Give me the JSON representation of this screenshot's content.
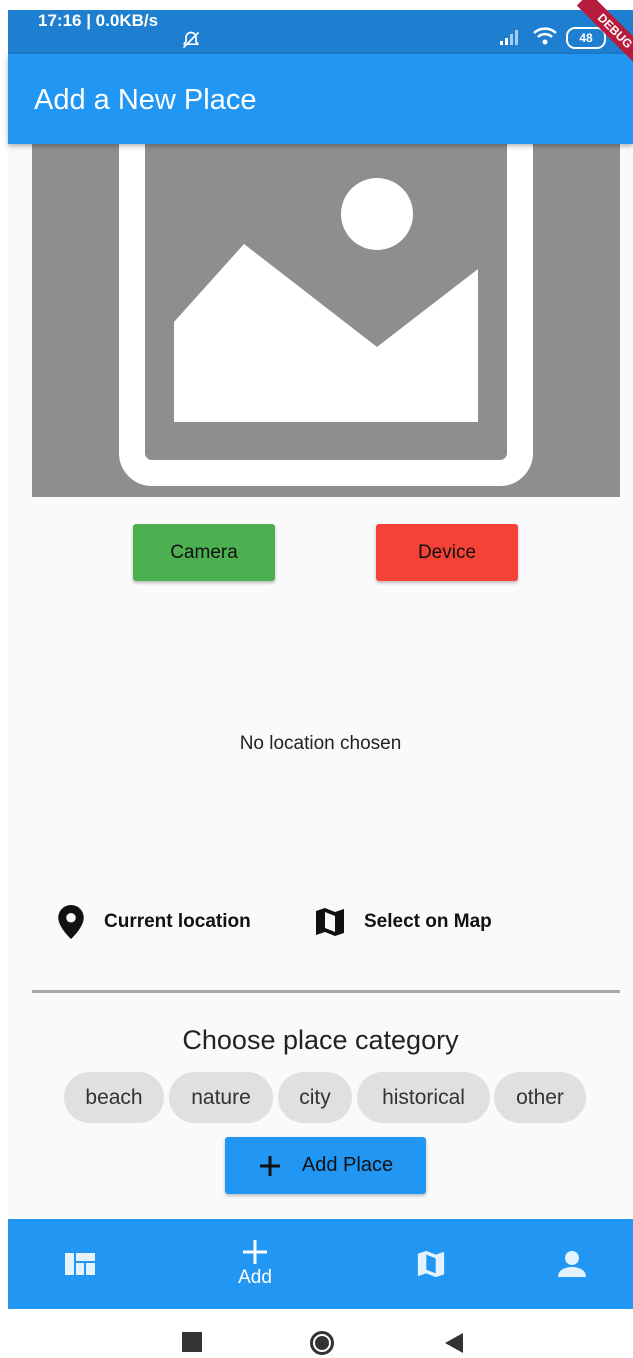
{
  "status_bar": {
    "time": "17:16 | 0.0KB/s",
    "battery": "48",
    "debug_banner": "DEBUG"
  },
  "app_bar": {
    "title": "Add a New Place"
  },
  "image_picker": {
    "camera_label": "Camera",
    "device_label": "Device",
    "camera_color": "#4CAF50",
    "device_color": "#F44336"
  },
  "location": {
    "status_text": "No location chosen",
    "current_location_label": "Current location",
    "select_on_map_label": "Select on Map"
  },
  "category": {
    "title": "Choose place category",
    "options": [
      "beach",
      "nature",
      "city",
      "historical",
      "other"
    ]
  },
  "add_place_label": "Add Place",
  "bottom_nav": {
    "items": [
      {
        "icon": "dashboard-icon",
        "label": ""
      },
      {
        "icon": "add-icon",
        "label": "Add"
      },
      {
        "icon": "map-icon",
        "label": ""
      },
      {
        "icon": "person-icon",
        "label": ""
      }
    ]
  },
  "colors": {
    "primary": "#2196F3",
    "status_bar": "#1E7FD0",
    "background": "#FAFAFA"
  }
}
